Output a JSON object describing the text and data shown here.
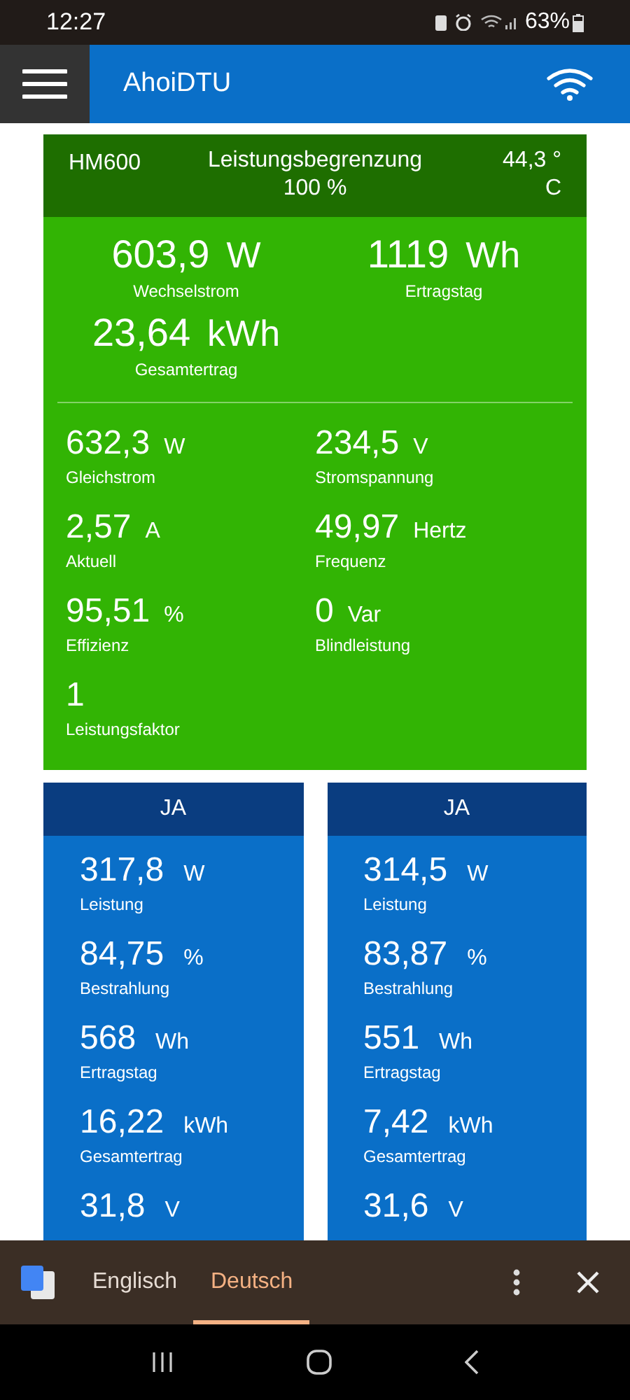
{
  "status_bar": {
    "time": "12:27",
    "battery": "63%"
  },
  "app_bar": {
    "title": "AhoiDTU"
  },
  "inverter": {
    "name": "HM600",
    "limit_label": "Leistungsbegrenzung",
    "limit_value": "100 %",
    "temperature": "44,3 °",
    "temperature_unit": "C",
    "main_metrics": [
      {
        "value": "603,9",
        "unit": "W",
        "label": "Wechselstrom"
      },
      {
        "value": "1119",
        "unit": "Wh",
        "label": "Ertragstag"
      },
      {
        "value": "23,64",
        "unit": "kWh",
        "label": "Gesamtertrag"
      }
    ],
    "metrics": [
      {
        "value": "632,3",
        "unit": "W",
        "label": "Gleichstrom"
      },
      {
        "value": "234,5",
        "unit": "V",
        "label": "Stromspannung"
      },
      {
        "value": "2,57",
        "unit": "A",
        "label": "Aktuell"
      },
      {
        "value": "49,97",
        "unit": "Hertz",
        "label": "Frequenz"
      },
      {
        "value": "95,51",
        "unit": "%",
        "label": "Effizienz"
      },
      {
        "value": "0",
        "unit": "Var",
        "label": "Blindleistung"
      },
      {
        "value": "1",
        "label": "Leistungsfaktor"
      }
    ]
  },
  "strings": [
    {
      "title": "JA",
      "metrics": [
        {
          "value": "317,8",
          "unit": "W",
          "label": "Leistung"
        },
        {
          "value": "84,75",
          "unit": "%",
          "label": "Bestrahlung"
        },
        {
          "value": "568",
          "unit": "Wh",
          "label": "Ertragstag"
        },
        {
          "value": "16,22",
          "unit": "kWh",
          "label": "Gesamtertrag"
        },
        {
          "value": "31,8",
          "unit": "V"
        }
      ]
    },
    {
      "title": "JA",
      "metrics": [
        {
          "value": "314,5",
          "unit": "W",
          "label": "Leistung"
        },
        {
          "value": "83,87",
          "unit": "%",
          "label": "Bestrahlung"
        },
        {
          "value": "551",
          "unit": "Wh",
          "label": "Ertragstag"
        },
        {
          "value": "7,42",
          "unit": "kWh",
          "label": "Gesamtertrag"
        },
        {
          "value": "31,6",
          "unit": "V"
        }
      ]
    }
  ],
  "translate_bar": {
    "languages": [
      {
        "label": "Englisch",
        "selected": false
      },
      {
        "label": "Deutsch",
        "selected": true
      }
    ]
  }
}
